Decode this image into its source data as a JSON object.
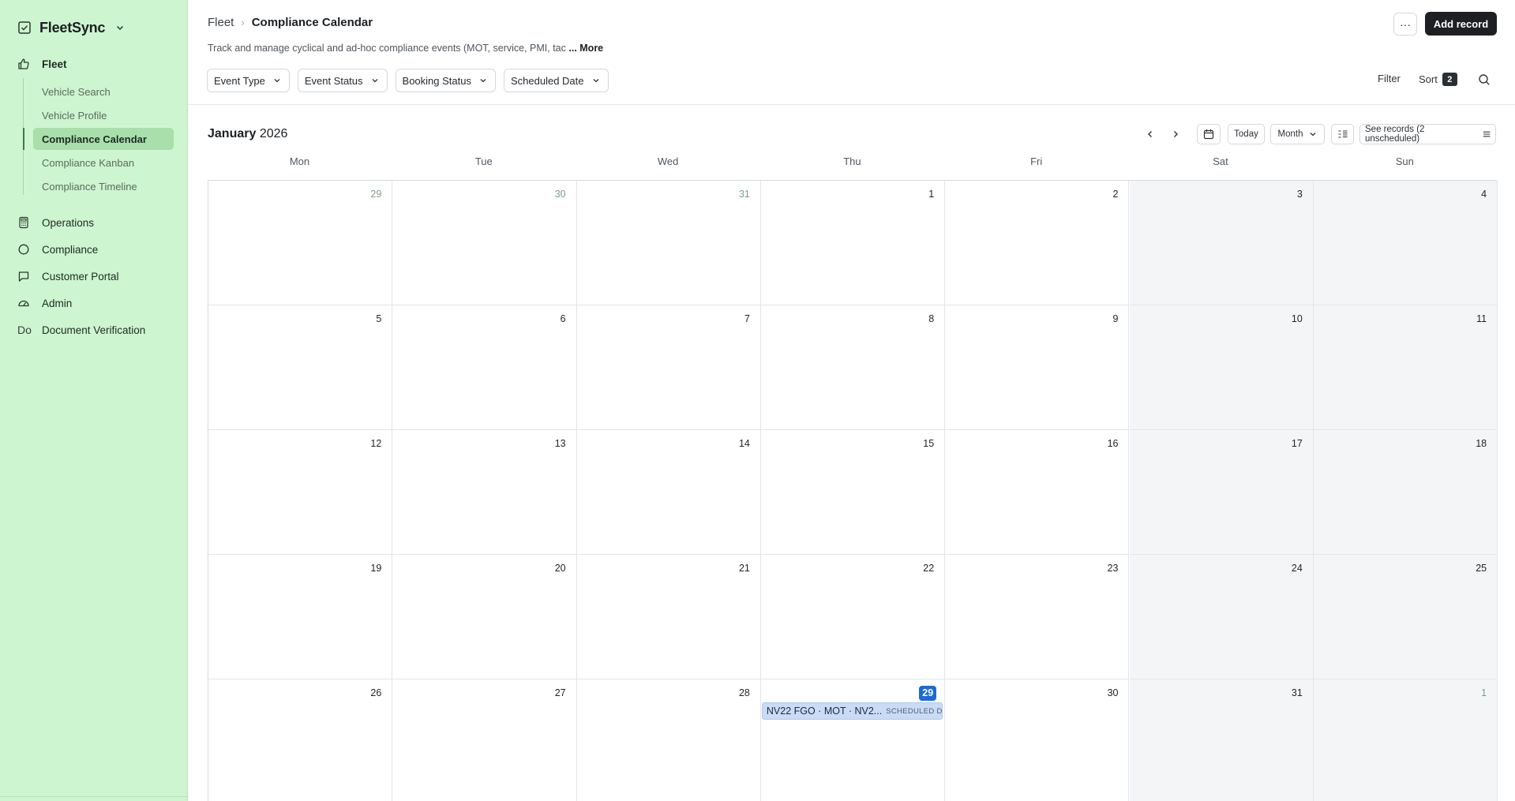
{
  "app": {
    "name": "FleetSync"
  },
  "sidebar": {
    "groups": [
      {
        "label": "Fleet",
        "icon": "thumbs-up-icon",
        "active": true
      },
      {
        "label": "Operations",
        "icon": "calculator-icon"
      },
      {
        "label": "Compliance",
        "icon": "circle-icon"
      },
      {
        "label": "Customer Portal",
        "icon": "chat-bubble-icon"
      },
      {
        "label": "Admin",
        "icon": "gauge-icon"
      },
      {
        "label": "Document Verification",
        "icon": "Do"
      }
    ],
    "fleet_items": [
      {
        "label": "Vehicle Search"
      },
      {
        "label": "Vehicle Profile"
      },
      {
        "label": "Compliance Calendar",
        "active": true
      },
      {
        "label": "Compliance Kanban"
      },
      {
        "label": "Compliance Timeline"
      }
    ]
  },
  "header": {
    "breadcrumb_parent": "Fleet",
    "breadcrumb_sep": "›",
    "title": "Compliance Calendar",
    "description": "Track and manage cyclical and ad-hoc compliance events (MOT, service, PMI, tac",
    "more_label": "... More",
    "more_menu": "···",
    "add_record": "Add record"
  },
  "filters": [
    "Event Type",
    "Event Status",
    "Booking Status",
    "Scheduled Date"
  ],
  "toolbar": {
    "filter": "Filter",
    "sort": "Sort",
    "sort_count": "2"
  },
  "calendar": {
    "month": "January",
    "year": "2026",
    "today_label": "Today",
    "view_label": "Month",
    "records_label": "See records (2 unscheduled)",
    "weekdays": [
      "Mon",
      "Tue",
      "Wed",
      "Thu",
      "Fri",
      "Sat",
      "Sun"
    ],
    "weeks": [
      [
        "29",
        "30",
        "31",
        "1",
        "2",
        "3",
        "4"
      ],
      [
        "5",
        "6",
        "7",
        "8",
        "9",
        "10",
        "11"
      ],
      [
        "12",
        "13",
        "14",
        "15",
        "16",
        "17",
        "18"
      ],
      [
        "19",
        "20",
        "21",
        "22",
        "23",
        "24",
        "25"
      ],
      [
        "26",
        "27",
        "28",
        "29",
        "30",
        "31",
        "1"
      ]
    ],
    "today": "29",
    "event": {
      "title": "NV22 FGO · MOT · NV2...",
      "status": "SCHEDULED D..."
    }
  },
  "colors": {
    "sidebar_bg": "#cdf5cf",
    "sidebar_active": "#a8dfab",
    "today_badge": "#1b6ad6",
    "event_bg": "#c9dbf5",
    "primary_button": "#1d1f22"
  }
}
